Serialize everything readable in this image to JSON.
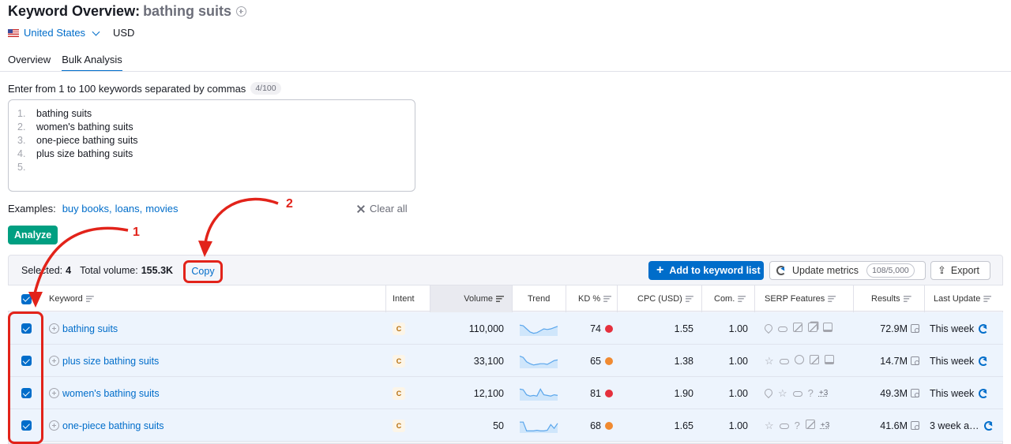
{
  "header": {
    "title": "Keyword Overview:",
    "keyword": "bathing suits",
    "database": "United States",
    "currency": "USD"
  },
  "tabs": [
    "Overview",
    "Bulk Analysis"
  ],
  "bulk": {
    "instruction": "Enter from 1 to 100 keywords separated by commas",
    "count_badge": "4/100",
    "lines": [
      {
        "n": "1.",
        "text": "bathing suits"
      },
      {
        "n": "2.",
        "text": "women's bathing suits"
      },
      {
        "n": "3.",
        "text": "one-piece bathing suits"
      },
      {
        "n": "4.",
        "text": "plus size bathing suits"
      },
      {
        "n": "5.",
        "text": ""
      }
    ],
    "examples_label": "Examples:",
    "examples": [
      "buy books,",
      "loans,",
      "movies"
    ],
    "clear_all": "Clear all",
    "analyze": "Analyze"
  },
  "toolbar": {
    "selected_label": "Selected:",
    "selected_count": "4",
    "total_volume_label": "Total volume:",
    "total_volume": "155.3K",
    "copy": "Copy",
    "add_to_list": "Add to keyword list",
    "update_metrics": "Update metrics",
    "update_badge": "108/5,000",
    "export": "Export"
  },
  "table": {
    "headers": {
      "keyword": "Keyword",
      "intent": "Intent",
      "volume": "Volume",
      "trend": "Trend",
      "kd": "KD %",
      "cpc": "CPC (USD)",
      "com": "Com.",
      "serp": "SERP Features",
      "results": "Results",
      "last_update": "Last Update"
    },
    "rows": [
      {
        "keyword": "bathing suits",
        "intent": "C",
        "volume": "110,000",
        "kd": "74",
        "kd_color": "#e5303d",
        "cpc": "1.55",
        "com": "1.00",
        "serp": [
          "pin-icon",
          "link-icon",
          "image-icon",
          "image-pack-icon",
          "video-icon"
        ],
        "serp_more": "",
        "results": "72.9M",
        "last_update": "This week",
        "trend": [
          0.2,
          0.25,
          0.5,
          0.75,
          0.85,
          0.8,
          0.65,
          0.5,
          0.55,
          0.5,
          0.4,
          0.3
        ]
      },
      {
        "keyword": "plus size bathing suits",
        "intent": "C",
        "volume": "33,100",
        "kd": "65",
        "kd_color": "#f08a31",
        "cpc": "1.38",
        "com": "1.00",
        "serp": [
          "star-icon",
          "link-icon",
          "play-icon",
          "image-icon",
          "video-icon"
        ],
        "serp_more": "",
        "results": "14.7M",
        "last_update": "This week",
        "trend": [
          0.1,
          0.2,
          0.55,
          0.7,
          0.8,
          0.75,
          0.7,
          0.7,
          0.75,
          0.6,
          0.45,
          0.4
        ]
      },
      {
        "keyword": "women's bathing suits",
        "intent": "C",
        "volume": "12,100",
        "kd": "81",
        "kd_color": "#e5303d",
        "cpc": "1.90",
        "com": "1.00",
        "serp": [
          "pin-icon",
          "star-icon",
          "link-icon",
          "question-icon"
        ],
        "serp_more": "+3",
        "results": "49.3M",
        "last_update": "This week",
        "trend": [
          0.15,
          0.2,
          0.6,
          0.7,
          0.65,
          0.7,
          0.15,
          0.6,
          0.65,
          0.7,
          0.6,
          0.65
        ]
      },
      {
        "keyword": "one-piece bathing suits",
        "intent": "C",
        "volume": "50",
        "kd": "68",
        "kd_color": "#f08a31",
        "cpc": "1.65",
        "com": "1.00",
        "serp": [
          "star-icon",
          "link-icon",
          "question-icon",
          "image-icon"
        ],
        "serp_more": "+3",
        "results": "41.6M",
        "last_update": "3 week a…",
        "trend": [
          0.2,
          0.2,
          0.9,
          0.9,
          0.9,
          0.85,
          0.9,
          0.9,
          0.85,
          0.4,
          0.7,
          0.3
        ]
      }
    ]
  },
  "annotations": [
    "1",
    "2"
  ],
  "colors": {
    "accent": "#006dca",
    "analyze": "#009f81",
    "annotation": "#e2231a"
  }
}
